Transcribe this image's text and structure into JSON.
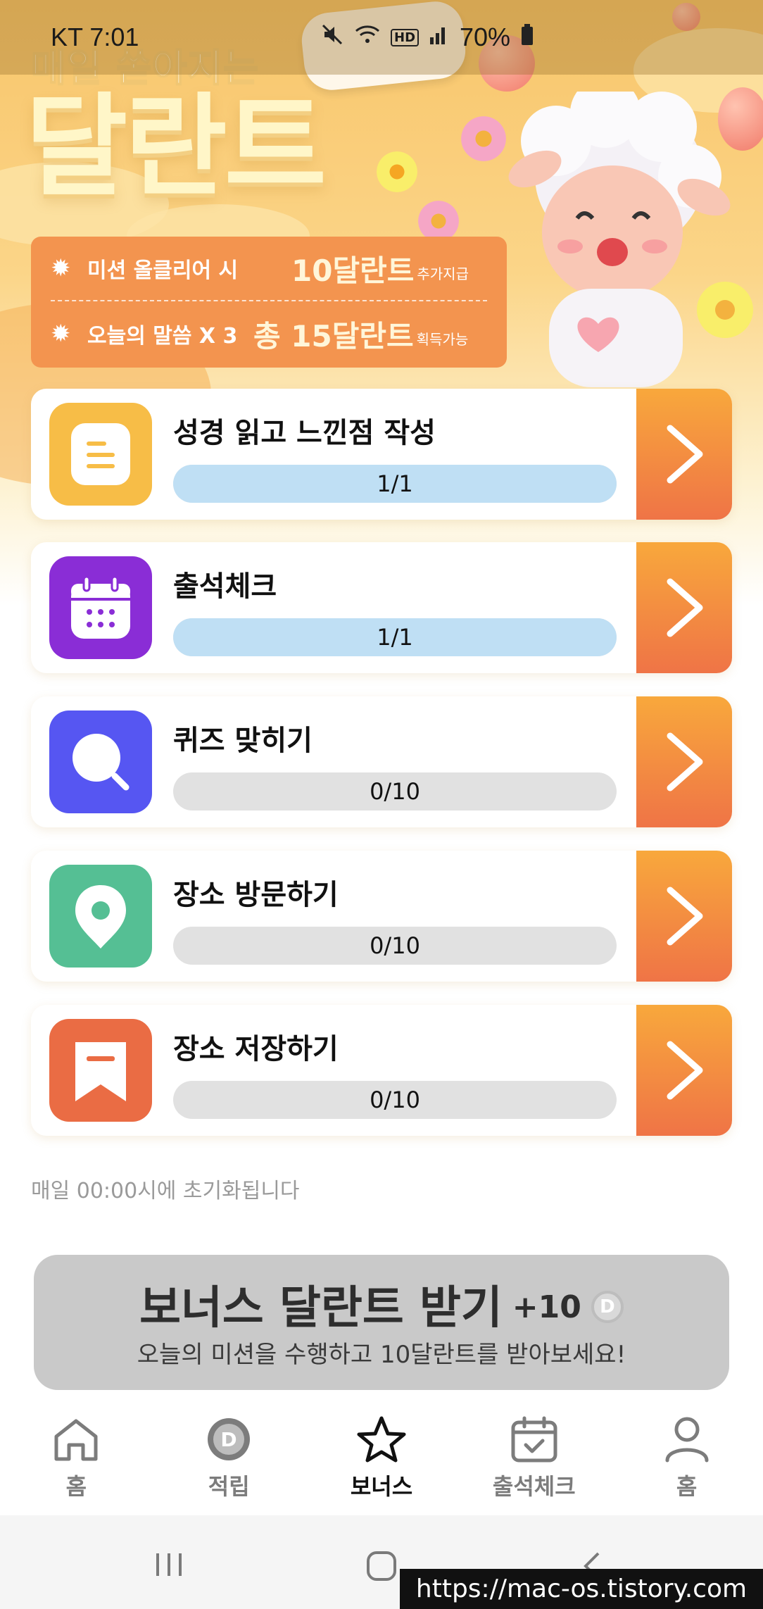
{
  "status_bar": {
    "carrier_time": "KT 7:01",
    "battery_pct": "70%"
  },
  "hero": {
    "subtitle": "매일 쏟아지는",
    "title": "달란트"
  },
  "info": {
    "row1_label": "미션 올클리어 시",
    "row1_value": "10달란트",
    "row1_suffix": "추가지급",
    "row2_label": "오늘의 말씀 X 3",
    "row2_value": "총 15달란트",
    "row2_suffix": "획득가능"
  },
  "missions": [
    {
      "title": "성경 읽고 느낀점 작성",
      "progress_text": "1/1",
      "progress": 1.0,
      "icon": "note-icon",
      "color": "#f7bd47"
    },
    {
      "title": "출석체크",
      "progress_text": "1/1",
      "progress": 1.0,
      "icon": "calendar-icon",
      "color": "#8a2dd6"
    },
    {
      "title": "퀴즈 맞히기",
      "progress_text": "0/10",
      "progress": 0.0,
      "icon": "search-icon",
      "color": "#5656f2"
    },
    {
      "title": "장소 방문하기",
      "progress_text": "0/10",
      "progress": 0.0,
      "icon": "location-pin-icon",
      "color": "#55bf94"
    },
    {
      "title": "장소 저장하기",
      "progress_text": "0/10",
      "progress": 0.0,
      "icon": "bookmark-icon",
      "color": "#ea6c44"
    }
  ],
  "reset_note": "매일 00:00시에 초기화됩니다",
  "bonus": {
    "title": "보너스 달란트 받기",
    "amount": "+10",
    "coin": "D",
    "subtitle": "오늘의 미션을 수행하고 10달란트를 받아보세요!"
  },
  "nav": {
    "items": [
      {
        "label": "홈",
        "icon": "home-icon"
      },
      {
        "label": "적립",
        "icon": "coin-icon"
      },
      {
        "label": "보너스",
        "icon": "star-icon",
        "active": true
      },
      {
        "label": "출석체크",
        "icon": "calendar-check-icon"
      },
      {
        "label": "홈",
        "icon": "person-icon"
      }
    ]
  },
  "watermark": "https://mac-os.tistory.com",
  "colors": {
    "accent_orange": "#f3944f",
    "arrow_gradient_top": "#f8a83c",
    "arrow_gradient_bottom": "#ef7446",
    "progress_done": "#bfdff4",
    "progress_empty": "#e1e1e1"
  }
}
